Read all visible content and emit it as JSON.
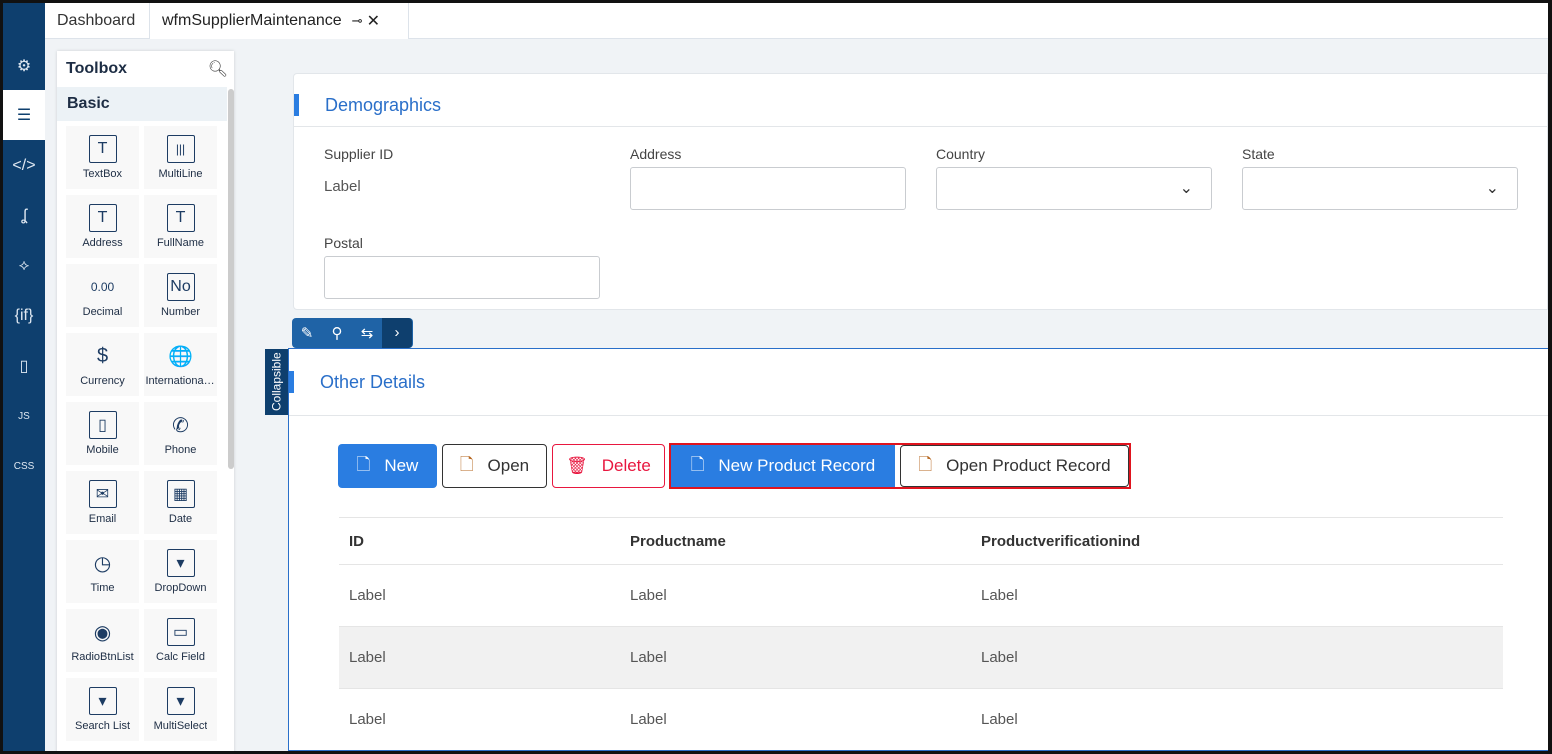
{
  "tabs": [
    {
      "label": "Dashboard"
    },
    {
      "label": "wfmSupplierMaintenance"
    }
  ],
  "toolbox": {
    "title": "Toolbox",
    "category": "Basic",
    "items": [
      {
        "label": "TextBox",
        "glyph": "T"
      },
      {
        "label": "MultiLine",
        "glyph": "|||"
      },
      {
        "label": "Address",
        "glyph": "T"
      },
      {
        "label": "FullName",
        "glyph": "T"
      },
      {
        "label": "Decimal",
        "glyph": "0.00"
      },
      {
        "label": "Number",
        "glyph": "No"
      },
      {
        "label": "Currency",
        "glyph": "$"
      },
      {
        "label": "International ...",
        "glyph": "🌐"
      },
      {
        "label": "Mobile",
        "glyph": "▯"
      },
      {
        "label": "Phone",
        "glyph": "✆"
      },
      {
        "label": "Email",
        "glyph": "✉"
      },
      {
        "label": "Date",
        "glyph": "▦"
      },
      {
        "label": "Time",
        "glyph": "◷"
      },
      {
        "label": "DropDown",
        "glyph": "▾"
      },
      {
        "label": "RadioBtnList",
        "glyph": "◉"
      },
      {
        "label": "Calc Field",
        "glyph": "▭"
      },
      {
        "label": "Search List",
        "glyph": "▾"
      },
      {
        "label": "MultiSelect",
        "glyph": "▾"
      }
    ]
  },
  "nav": {
    "if_label": "{if}",
    "js_label": "JS",
    "css_label": "CSS"
  },
  "demographics": {
    "title": "Demographics",
    "supplier_id_label": "Supplier ID",
    "supplier_id_value": "Label",
    "address_label": "Address",
    "country_label": "Country",
    "state_label": "State",
    "postal_label": "Postal"
  },
  "collapsible_label": "Collapsible",
  "other": {
    "title": "Other Details",
    "buttons": {
      "new": "New",
      "open": "Open",
      "delete": "Delete",
      "new_product": "New Product Record",
      "open_product": "Open Product Record"
    },
    "columns": [
      "ID",
      "Productname",
      "Productverificationind"
    ],
    "rows": [
      [
        "Label",
        "Label",
        "Label"
      ],
      [
        "Label",
        "Label",
        "Label"
      ],
      [
        "Label",
        "Label",
        "Label"
      ]
    ]
  },
  "colors": {
    "nav": "#0e3f6e",
    "accent": "#2a7de1",
    "danger": "#e8173f",
    "highlight": "#e0141e"
  }
}
